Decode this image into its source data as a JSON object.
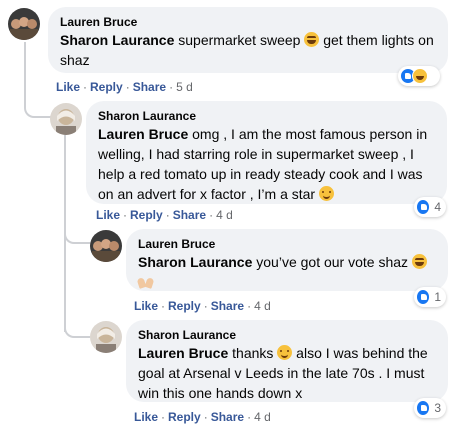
{
  "comments": [
    {
      "author": "Lauren Bruce",
      "mention": "Sharon Laurance",
      "text": " supermarket sweep ",
      "text_after": " get them lights on shaz",
      "actions": {
        "like": "Like",
        "reply": "Reply",
        "share": "Share",
        "time": "5 d"
      },
      "reactions": {
        "icons": [
          "like-icon",
          "haha-icon"
        ],
        "count": ""
      }
    },
    {
      "author": "Sharon Laurance",
      "mention": "Lauren Bruce",
      "text": " omg , I am the most famous person in welling, I had starring role in supermarket sweep , I help a red tomato up in ready steady cook and I was on an advert for x factor , I’m a star ",
      "actions": {
        "like": "Like",
        "reply": "Reply",
        "share": "Share",
        "time": "4 d"
      },
      "reactions": {
        "icons": [
          "like-icon"
        ],
        "count": "4"
      }
    },
    {
      "author": "Lauren Bruce",
      "mention": "Sharon Laurance",
      "text": " you’ve got our vote shaz ",
      "actions": {
        "like": "Like",
        "reply": "Reply",
        "share": "Share",
        "time": "4 d"
      },
      "reactions": {
        "icons": [
          "like-icon"
        ],
        "count": "1"
      }
    },
    {
      "author": "Sharon Laurance",
      "mention": "Lauren Bruce",
      "text": " thanks ",
      "text_after": " also I was behind the goal at Arsenal v Leeds in the late 70s . I must win this one hands down x",
      "actions": {
        "like": "Like",
        "reply": "Reply",
        "share": "Share",
        "time": "4 d"
      },
      "reactions": {
        "icons": [
          "like-icon"
        ],
        "count": "3"
      }
    }
  ],
  "colors": {
    "bubble": "#f0f2f5",
    "link": "#385898",
    "meta": "#65676b",
    "like": "#1877f2"
  }
}
